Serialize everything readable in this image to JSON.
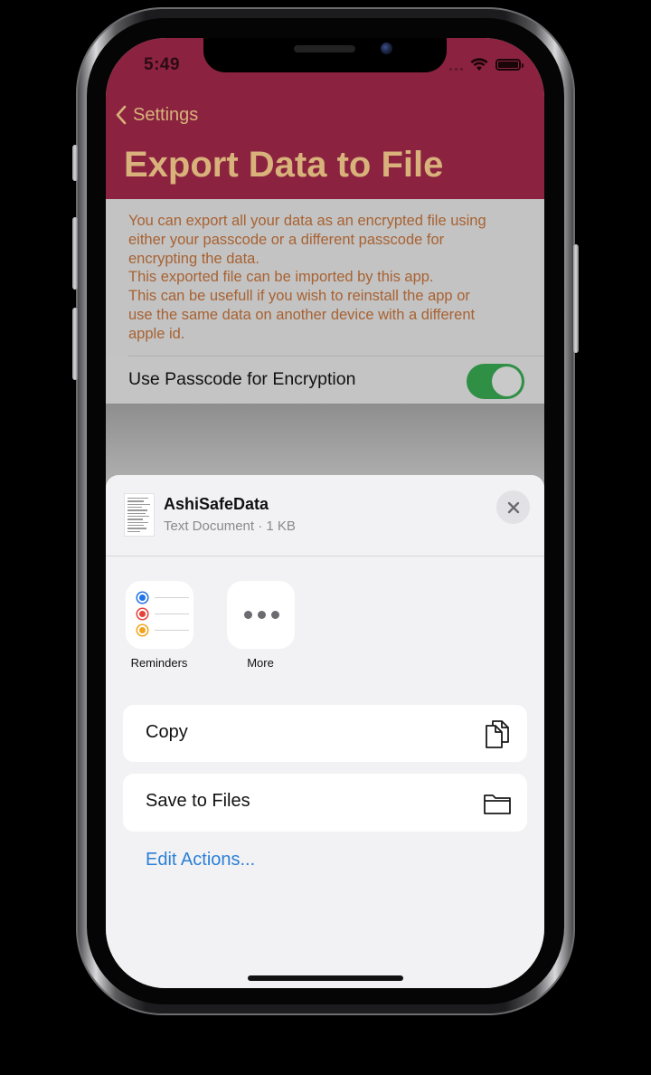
{
  "status_bar": {
    "time": "5:49"
  },
  "nav": {
    "back_label": "Settings",
    "title": "Export Data to File"
  },
  "description_lines": [
    "You can export all your data as an encrypted file using",
    "either your passcode or a different passcode for",
    "encrypting the data.",
    "This exported file can be imported by this app.",
    "This can be usefull if you wish to reinstall the app or",
    "use the same data on another device with a different",
    "apple id."
  ],
  "passcode_toggle": {
    "label": "Use Passcode for Encryption",
    "on": true
  },
  "share_sheet": {
    "file_name": "AshiSafeData",
    "file_meta": "Text Document · 1 KB",
    "apps": [
      {
        "label": "Reminders",
        "icon": "reminders-icon"
      },
      {
        "label": "More",
        "icon": "more-icon"
      }
    ],
    "actions": [
      {
        "label": "Copy",
        "icon": "copy-icon"
      },
      {
        "label": "Save to Files",
        "icon": "folder-icon"
      }
    ],
    "edit_actions_label": "Edit Actions..."
  },
  "colors": {
    "nav_background": "#8b2340",
    "accent_gold": "#d8b27a",
    "description_text": "#a86232",
    "toggle_on": "#2e8f45",
    "link_blue": "#2c7fd6"
  }
}
